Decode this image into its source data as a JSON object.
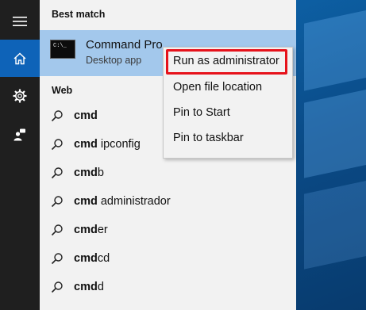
{
  "rail": {
    "items": [
      {
        "icon": "hamburger-menu-icon"
      },
      {
        "icon": "home-icon",
        "active": true
      },
      {
        "icon": "gear-icon"
      },
      {
        "icon": "feedback-person-icon"
      }
    ]
  },
  "best_match": {
    "heading": "Best match",
    "app_title": "Command Pro",
    "app_subtitle": "Desktop app",
    "icon_prompt": "C:\\_"
  },
  "web": {
    "heading": "Web",
    "results": [
      {
        "bold": "cmd",
        "rest": ""
      },
      {
        "bold": "cmd",
        "rest": " ipconfig"
      },
      {
        "bold": "cmd",
        "rest": "b"
      },
      {
        "bold": "cmd",
        "rest": " administrador"
      },
      {
        "bold": "cmd",
        "rest": "er"
      },
      {
        "bold": "cmd",
        "rest": "cd"
      },
      {
        "bold": "cmd",
        "rest": "d"
      }
    ]
  },
  "context_menu": {
    "items": [
      "Run as administrator",
      "Open file location",
      "Pin to Start",
      "Pin to taskbar"
    ]
  },
  "colors": {
    "rail_bg": "#1f1f1f",
    "accent": "#0e63b8",
    "selection": "#a3c8ec",
    "highlight_box": "#e6121b"
  }
}
